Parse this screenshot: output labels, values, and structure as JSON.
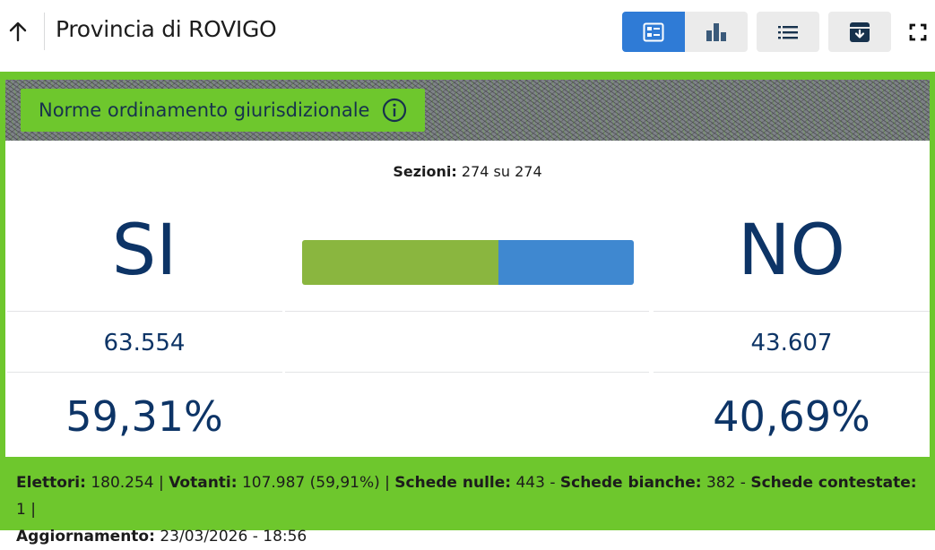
{
  "header": {
    "title": "Provincia di ROVIGO",
    "view_buttons": [
      {
        "name": "card-view",
        "active": true
      },
      {
        "name": "chart-view",
        "active": false
      },
      {
        "name": "list-view",
        "active": false
      },
      {
        "name": "archive",
        "active": false
      }
    ]
  },
  "colors": {
    "accent_blue": "#2f7bd6",
    "frame_green": "#6ec72d",
    "si_bar": "#8ab63f",
    "no_bar": "#3f88d0",
    "text_navy": "#0d3466"
  },
  "quesito": {
    "label": "Norme ordinamento giurisdizionale"
  },
  "sezioni": {
    "label": "Sezioni:",
    "value": "274 su 274"
  },
  "results": {
    "si": {
      "label": "SI",
      "votes": "63.554",
      "percent": "59,31%",
      "share": 59.31
    },
    "no": {
      "label": "NO",
      "votes": "43.607",
      "percent": "40,69%",
      "share": 40.69
    }
  },
  "footer": {
    "elettori_label": "Elettori:",
    "elettori_value": "180.254",
    "votanti_label": "Votanti:",
    "votanti_value": "107.987 (59,91%)",
    "nulle_label": "Schede nulle:",
    "nulle_value": "443",
    "bianche_label": "Schede bianche:",
    "bianche_value": "382",
    "contestate_label": "Schede contestate:",
    "contestate_value": "1",
    "aggiornamento_label": "Aggiornamento:",
    "aggiornamento_value": "23/03/2026 - 18:56"
  }
}
